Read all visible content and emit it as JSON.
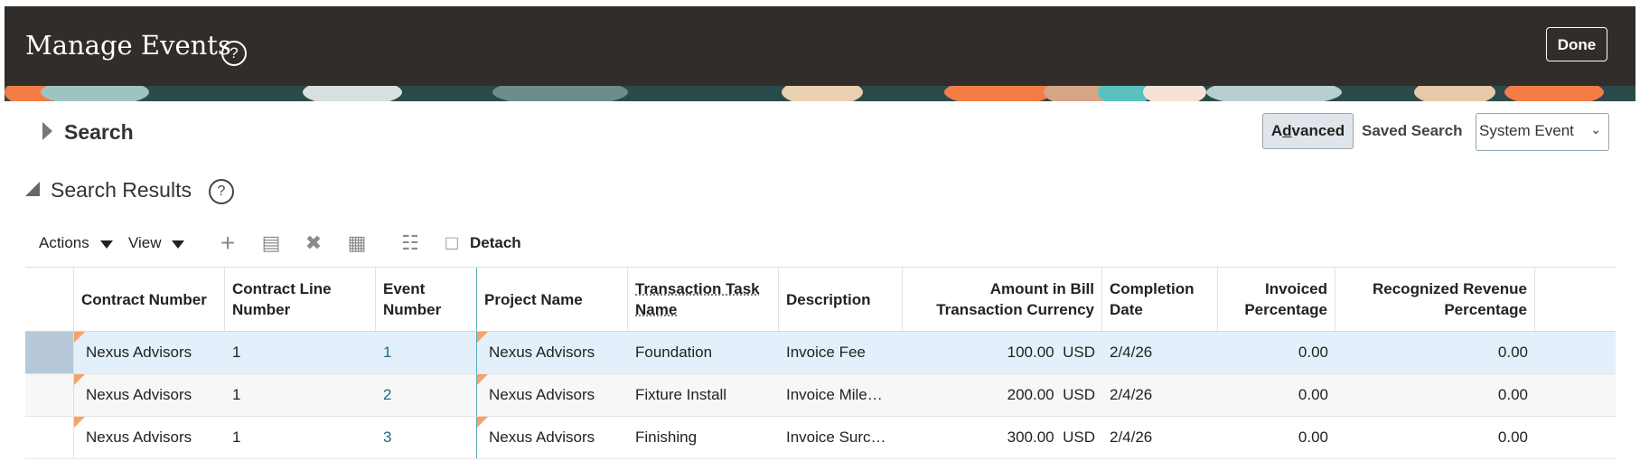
{
  "header": {
    "title": "Manage Events",
    "done_label": "Done"
  },
  "search": {
    "label": "Search",
    "advanced_label": "Advanced",
    "saved_search_label": "Saved Search",
    "saved_search_value": "System Event"
  },
  "results": {
    "label": "Search Results",
    "toolbar": {
      "actions_label": "Actions",
      "view_label": "View",
      "detach_label": "Detach"
    },
    "columns": [
      "Contract Number",
      "Contract Line Number",
      "Event Number",
      "Project Name",
      "Transaction Task Name",
      "Description",
      "Amount in Bill Transaction Currency",
      "Completion Date",
      "Invoiced Percentage",
      "Recognized Revenue Percentage"
    ],
    "rows": [
      {
        "contract_number": "Nexus Advisors",
        "contract_line": "1",
        "event_number": "1",
        "project_name": "Nexus Advisors",
        "task_name": "Foundation",
        "description": "Invoice Fee",
        "amount": "100.00",
        "currency": "USD",
        "completion_date": "2/4/26",
        "invoiced_pct": "0.00",
        "revenue_pct": "0.00"
      },
      {
        "contract_number": "Nexus Advisors",
        "contract_line": "1",
        "event_number": "2",
        "project_name": "Nexus Advisors",
        "task_name": "Fixture Install",
        "description": "Invoice Mile…",
        "amount": "200.00",
        "currency": "USD",
        "completion_date": "2/4/26",
        "invoiced_pct": "0.00",
        "revenue_pct": "0.00"
      },
      {
        "contract_number": "Nexus Advisors",
        "contract_line": "1",
        "event_number": "3",
        "project_name": "Nexus Advisors",
        "task_name": "Finishing",
        "description": "Invoice Surc…",
        "amount": "300.00",
        "currency": "USD",
        "completion_date": "2/4/26",
        "invoiced_pct": "0.00",
        "revenue_pct": "0.00"
      }
    ]
  },
  "icons": {
    "help": "question-circle-icon",
    "add": "plus-icon",
    "duplicate": "copy-icon",
    "delete": "x-icon",
    "freeze": "freeze-columns-icon",
    "query_by_example": "filter-icon",
    "detach": "detach-icon"
  },
  "colors": {
    "header_bg": "#312d2a",
    "selected_row": "#e3f0fb",
    "link": "#1e6a86",
    "corner_marker": "#f5a36b"
  }
}
